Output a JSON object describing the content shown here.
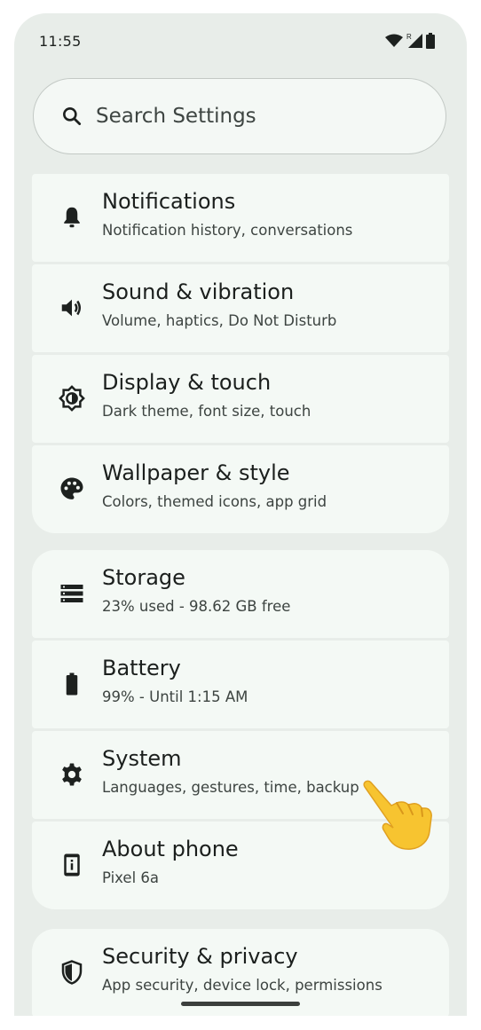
{
  "status_bar": {
    "time": "11:55",
    "icons": [
      "wifi-icon",
      "roaming-indicator",
      "signal-icon",
      "battery-icon"
    ],
    "roaming_label": "R"
  },
  "search": {
    "placeholder": "Search Settings"
  },
  "groups": [
    {
      "items": [
        {
          "title": "Notifications",
          "subtitle": "Notification history, conversations",
          "icon": "bell-icon"
        },
        {
          "title": "Sound & vibration",
          "subtitle": "Volume, haptics, Do Not Disturb",
          "icon": "speaker-icon"
        },
        {
          "title": "Display & touch",
          "subtitle": "Dark theme, font size, touch",
          "icon": "brightness-icon"
        },
        {
          "title": "Wallpaper & style",
          "subtitle": "Colors, themed icons, app grid",
          "icon": "palette-icon"
        }
      ]
    },
    {
      "items": [
        {
          "title": "Storage",
          "subtitle": "23% used - 98.62 GB free",
          "icon": "storage-icon"
        },
        {
          "title": "Battery",
          "subtitle": "99% - Until 1:15 AM",
          "icon": "battery-icon"
        },
        {
          "title": "System",
          "subtitle": "Languages, gestures, time, backup",
          "icon": "gear-icon"
        },
        {
          "title": "About phone",
          "subtitle": "Pixel 6a",
          "icon": "phone-info-icon"
        }
      ]
    },
    {
      "items": [
        {
          "title": "Security & privacy",
          "subtitle": "App security, device lock, permissions",
          "icon": "shield-icon"
        }
      ]
    }
  ],
  "colors": {
    "background": "#e8ede9",
    "card": "#f4f9f5",
    "icon": "#1d211f"
  }
}
